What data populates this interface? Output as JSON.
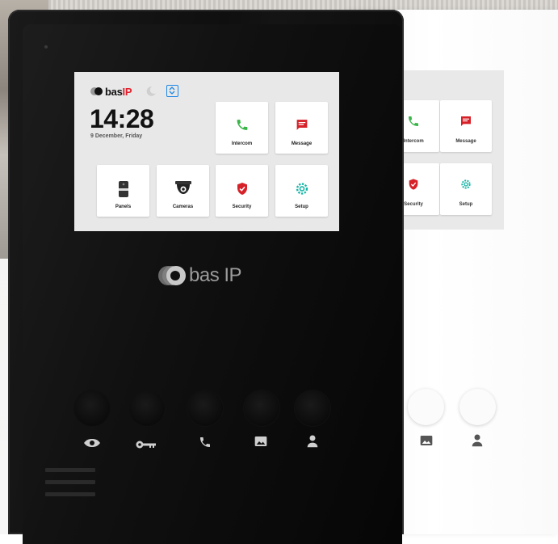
{
  "screen": {
    "brand": {
      "name": "bas",
      "suffix": "IP"
    },
    "time": "14:28",
    "date": "9 December, Friday",
    "tiles": [
      {
        "label": "Intercom",
        "icon": "phone-icon",
        "color": "#3bb54a"
      },
      {
        "label": "Message",
        "icon": "message-icon",
        "color": "#d62128"
      },
      {
        "label": "Panels",
        "icon": "panel-icon",
        "color": "#222222"
      },
      {
        "label": "Cameras",
        "icon": "camera-icon",
        "color": "#222222"
      },
      {
        "label": "Security",
        "icon": "shield-icon",
        "color": "#d62128"
      },
      {
        "label": "Setup",
        "icon": "gear-icon",
        "color": "#18b5a6"
      }
    ]
  },
  "back_screen": {
    "tiles": [
      {
        "label": "Intercom"
      },
      {
        "label": "Message"
      },
      {
        "label": "Security"
      },
      {
        "label": "Setup"
      }
    ]
  },
  "panel": {
    "brand": "bas IP",
    "buttons": [
      {
        "icon": "eye-icon"
      },
      {
        "icon": "key-icon"
      },
      {
        "icon": "phone-icon"
      },
      {
        "icon": "image-icon"
      },
      {
        "icon": "user-icon"
      }
    ]
  }
}
